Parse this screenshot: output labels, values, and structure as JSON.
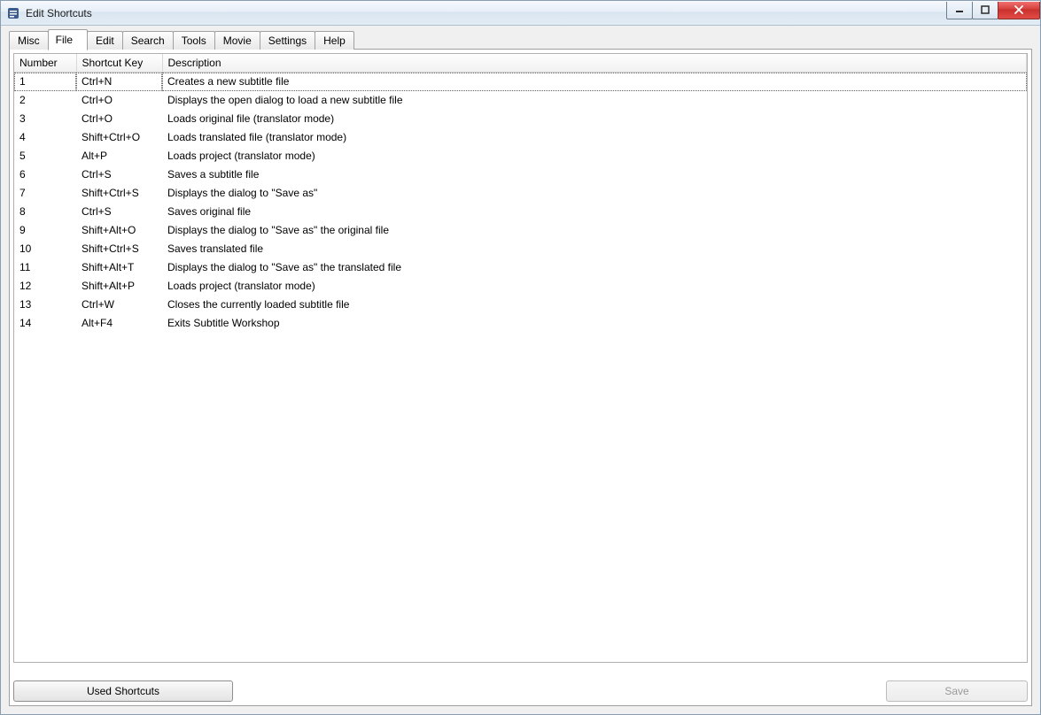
{
  "window": {
    "title": "Edit Shortcuts"
  },
  "tabs": [
    {
      "label": "Misc"
    },
    {
      "label": "File"
    },
    {
      "label": "Edit"
    },
    {
      "label": "Search"
    },
    {
      "label": "Tools"
    },
    {
      "label": "Movie"
    },
    {
      "label": "Settings"
    },
    {
      "label": "Help"
    }
  ],
  "active_tab_index": 1,
  "columns": {
    "number": "Number",
    "key": "Shortcut Key",
    "description": "Description"
  },
  "rows": [
    {
      "number": "1",
      "key": "Ctrl+N",
      "description": "Creates a new subtitle file"
    },
    {
      "number": "2",
      "key": "Ctrl+O",
      "description": "Displays the open dialog to load a new subtitle file"
    },
    {
      "number": "3",
      "key": "Ctrl+O",
      "description": "Loads original file (translator mode)"
    },
    {
      "number": "4",
      "key": "Shift+Ctrl+O",
      "description": "Loads translated file (translator mode)"
    },
    {
      "number": "5",
      "key": "Alt+P",
      "description": "Loads project (translator mode)"
    },
    {
      "number": "6",
      "key": "Ctrl+S",
      "description": "Saves a subtitle file"
    },
    {
      "number": "7",
      "key": "Shift+Ctrl+S",
      "description": "Displays the dialog to \"Save as\""
    },
    {
      "number": "8",
      "key": "Ctrl+S",
      "description": "Saves original file"
    },
    {
      "number": "9",
      "key": "Shift+Alt+O",
      "description": "Displays the dialog to \"Save as\" the original file"
    },
    {
      "number": "10",
      "key": "Shift+Ctrl+S",
      "description": "Saves translated file"
    },
    {
      "number": "11",
      "key": "Shift+Alt+T",
      "description": "Displays the dialog to \"Save as\" the translated file"
    },
    {
      "number": "12",
      "key": "Shift+Alt+P",
      "description": "Loads project (translator mode)"
    },
    {
      "number": "13",
      "key": "Ctrl+W",
      "description": "Closes the currently loaded subtitle file"
    },
    {
      "number": "14",
      "key": "Alt+F4",
      "description": "Exits Subtitle Workshop"
    }
  ],
  "buttons": {
    "used_shortcuts": "Used Shortcuts",
    "save": "Save"
  }
}
